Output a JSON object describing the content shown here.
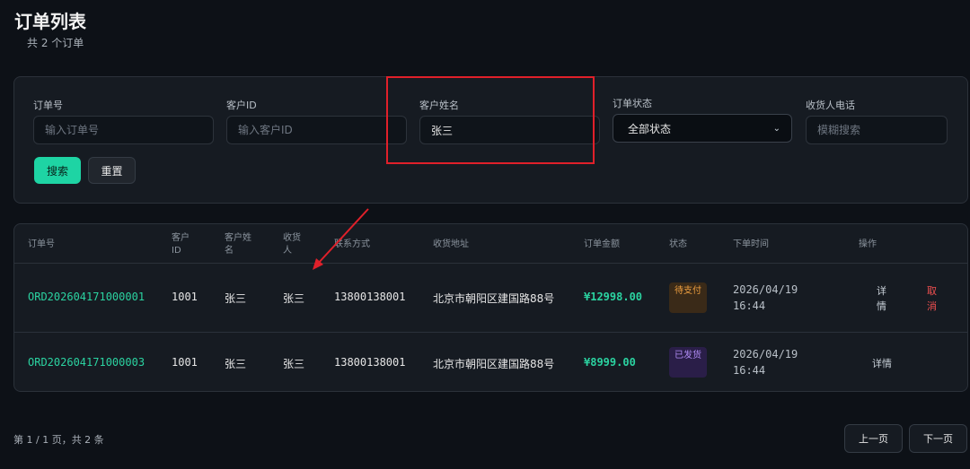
{
  "header": {
    "title": "订单列表",
    "subtitle": "共 2 个订单"
  },
  "filters": {
    "order_no": {
      "label": "订单号",
      "placeholder": "输入订单号",
      "value": ""
    },
    "customer_id": {
      "label": "客户ID",
      "placeholder": "输入客户ID",
      "value": ""
    },
    "customer_name": {
      "label": "客户姓名",
      "placeholder": "",
      "value": "张三"
    },
    "order_status": {
      "label": "订单状态",
      "selected": "全部状态"
    },
    "receiver_phone": {
      "label": "收货人电话",
      "placeholder": "模糊搜索",
      "value": ""
    },
    "search_label": "搜索",
    "reset_label": "重置"
  },
  "table": {
    "columns": [
      "订单号",
      "客户ID",
      "客户姓名",
      "收货人",
      "联系方式",
      "收货地址",
      "订单金额",
      "状态",
      "下单时间",
      "操作"
    ],
    "rows": [
      {
        "order_no": "ORD202604171000001",
        "customer_id": "1001",
        "customer_name": "张三",
        "receiver": "张三",
        "phone": "13800138001",
        "address": "北京市朝阳区建国路88号",
        "amount": "¥12998.00",
        "status": "待支付",
        "date": "2026/04/19",
        "time": "16:44",
        "action_detail": "详情",
        "action_cancel": "取消"
      },
      {
        "order_no": "ORD202604171000003",
        "customer_id": "1001",
        "customer_name": "张三",
        "receiver": "张三",
        "phone": "13800138001",
        "address": "北京市朝阳区建国路88号",
        "amount": "¥8999.00",
        "status": "已发货",
        "date": "2026/04/19",
        "time": "16:44",
        "action_detail": "详情"
      }
    ]
  },
  "pagination": {
    "info": "第 1 / 1 页，共 2 条",
    "prev_label": "上一页",
    "next_label": "下一页"
  },
  "colors": {
    "accent": "#1ed4a4",
    "highlight": "#e0202a",
    "pending": "#f0a040",
    "shipped": "#b08cf5",
    "cancel": "#f05050"
  }
}
